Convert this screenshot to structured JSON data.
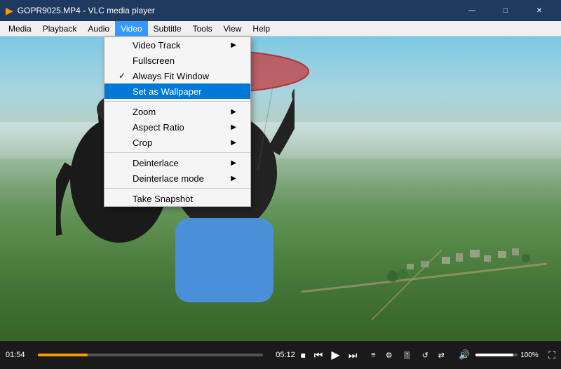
{
  "titleBar": {
    "icon": "▶",
    "title": "GOPR9025.MP4 - VLC media player",
    "minimize": "—",
    "maximize": "□",
    "close": "✕"
  },
  "menuBar": {
    "items": [
      "Media",
      "Playback",
      "Audio",
      "Video",
      "Subtitle",
      "Tools",
      "View",
      "Help"
    ]
  },
  "videoMenu": {
    "items": [
      {
        "id": "video-track",
        "label": "Video Track",
        "hasSubmenu": true,
        "checked": false,
        "separator": false
      },
      {
        "id": "fullscreen",
        "label": "Fullscreen",
        "hasSubmenu": false,
        "checked": false,
        "separator": false
      },
      {
        "id": "always-fit",
        "label": "Always Fit Window",
        "hasSubmenu": false,
        "checked": true,
        "separator": false
      },
      {
        "id": "set-wallpaper",
        "label": "Set as Wallpaper",
        "hasSubmenu": false,
        "checked": false,
        "separator": false,
        "highlighted": true
      },
      {
        "id": "sep1",
        "separator": true
      },
      {
        "id": "zoom",
        "label": "Zoom",
        "hasSubmenu": true,
        "checked": false,
        "separator": false
      },
      {
        "id": "aspect-ratio",
        "label": "Aspect Ratio",
        "hasSubmenu": true,
        "checked": false,
        "separator": false
      },
      {
        "id": "crop",
        "label": "Crop",
        "hasSubmenu": true,
        "checked": false,
        "separator": false
      },
      {
        "id": "sep2",
        "separator": true
      },
      {
        "id": "deinterlace",
        "label": "Deinterlace",
        "hasSubmenu": true,
        "checked": false,
        "separator": false
      },
      {
        "id": "deinterlace-mode",
        "label": "Deinterlace mode",
        "hasSubmenu": true,
        "checked": false,
        "separator": false
      },
      {
        "id": "sep3",
        "separator": true
      },
      {
        "id": "take-snapshot",
        "label": "Take Snapshot",
        "hasSubmenu": false,
        "checked": false,
        "separator": false
      }
    ]
  },
  "controlBar": {
    "timeElapsed": "01:54",
    "timeTotal": "05:12",
    "volumePercent": "100%"
  }
}
